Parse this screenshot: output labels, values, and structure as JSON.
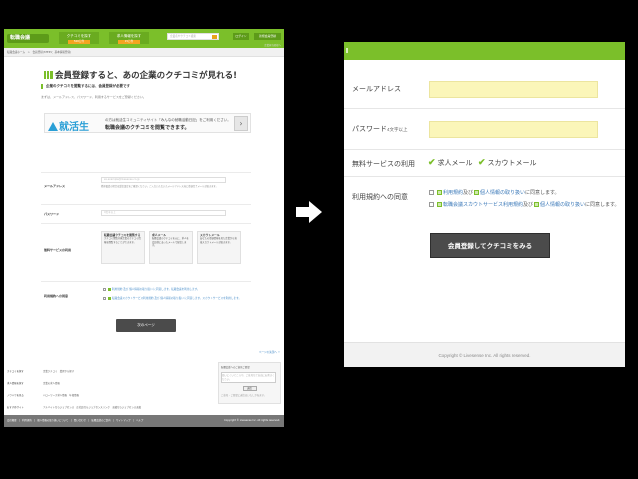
{
  "left": {
    "logo": "転職会議",
    "nav": [
      {
        "label": "クチコミを探す",
        "tag": "500万件"
      },
      {
        "label": "求人情報を探す",
        "tag": "15万件"
      }
    ],
    "search_placeholder": "企業名やクチコミ検索",
    "header_buttons": [
      "ログイン",
      "新規会員登録"
    ],
    "header_sub": "企業担当者様へ",
    "breadcrumb": "転職会議ホーム　>　会員登録(STEP1：基本情報登録)",
    "title": "会員登録すると、あの企業のクチコミが見れる!",
    "intro": "企業のクチコミを閲覧するには、会員登録が必要です",
    "intro_sub": "まずは、メールアドレス、パスワード、利用するサービスをご登録ください。",
    "banner": {
      "logo": "就活生",
      "line1": "の方は就活生コミュニティサイト「みんなの就職活動日記」をご利用ください。",
      "line2": "転職会議のクチコミを閲覧できます。",
      "arrow": "›"
    },
    "form": {
      "email_label": "メールアドレス",
      "email_placeholder": "ex.example@livesense.co.jp",
      "email_note": "携帯電話の場合は受信設定をご確認ください。ご入力いただいたメールアドレス宛に登録完了メールが届きます。",
      "password_label": "パスワード",
      "password_placeholder": "4文字以上",
      "service_label": "無料サービスの利用",
      "services": [
        {
          "title": "転職会議クチコミを閲覧する",
          "desc": "クチコミ閲覧対象企業のクチコミ情報を閲覧することができます。"
        },
        {
          "title": "求人メール",
          "desc": "転職会議のクチコミを元に、求人を会員様にあったメールで配信します。"
        },
        {
          "title": "スカウトメール",
          "desc": "あなたの登録情報を見た企業から直接スカウトメールが届きます。"
        }
      ],
      "agree_label": "利用規約への同意",
      "agree1": "利用規約 及び 個人情報の取り扱い に同意します。転職会議を利用します。",
      "agree2": "転職会議スカウトサービス利用規約 及び 個人情報の取り扱い に同意します。スカウトサービスを利用します。",
      "next_button": "次のページ"
    },
    "pagetop": "ページの先頭へ ↑",
    "footer_links": [
      {
        "head": "クチコミを探す",
        "items": "企業クチコミ　業界から探す"
      },
      {
        "head": "求人情報を探す",
        "items": "企業の求人情報"
      },
      {
        "head": "ノウハウを見る",
        "items": "ハローワーク求人情報　年収情報"
      },
      {
        "head": "おすすめサイト",
        "items": "アルバイトならジョブセンス　正社員ならジョブセンスリンク　派遣ならジョブセンス派遣"
      }
    ],
    "side_box": {
      "title": "転職会議へのご意見ご要望",
      "placeholder": "使いにくいところや、ご意見など自由にお書きください。",
      "button": "送信",
      "note": "ご意見・ご要望に返信はいたしかねます。"
    },
    "bottom_links": "会社概要　|　利用規約　|　個人情報の取り扱いについて　|　問い合わせ　|　転職会議のご案内　|　サイトマップ　|　ヘルプ",
    "copyright": "Copyright © Livesense Inc. All rights reserved."
  },
  "right": {
    "email_label": "メールアドレス",
    "password_label": "パスワード",
    "password_sub": "4文字以上",
    "service_label": "無料サービスの利用",
    "service_options": [
      "求人メール",
      "スカウトメール"
    ],
    "agree_label": "利用規約への同意",
    "agree_lines": [
      {
        "a": "利用規約",
        "mid": "及び",
        "b": "個人情報の取り扱い",
        "tail": "に同意します。"
      },
      {
        "a": "転職会議スカウトサービス利用規約",
        "mid": "及び",
        "b": "個人情報の取り扱い",
        "tail": "に同意します。"
      }
    ],
    "submit": "会員登録してクチコミをみる",
    "footer": "Copyright © Livesense Inc. All rights reserved."
  }
}
